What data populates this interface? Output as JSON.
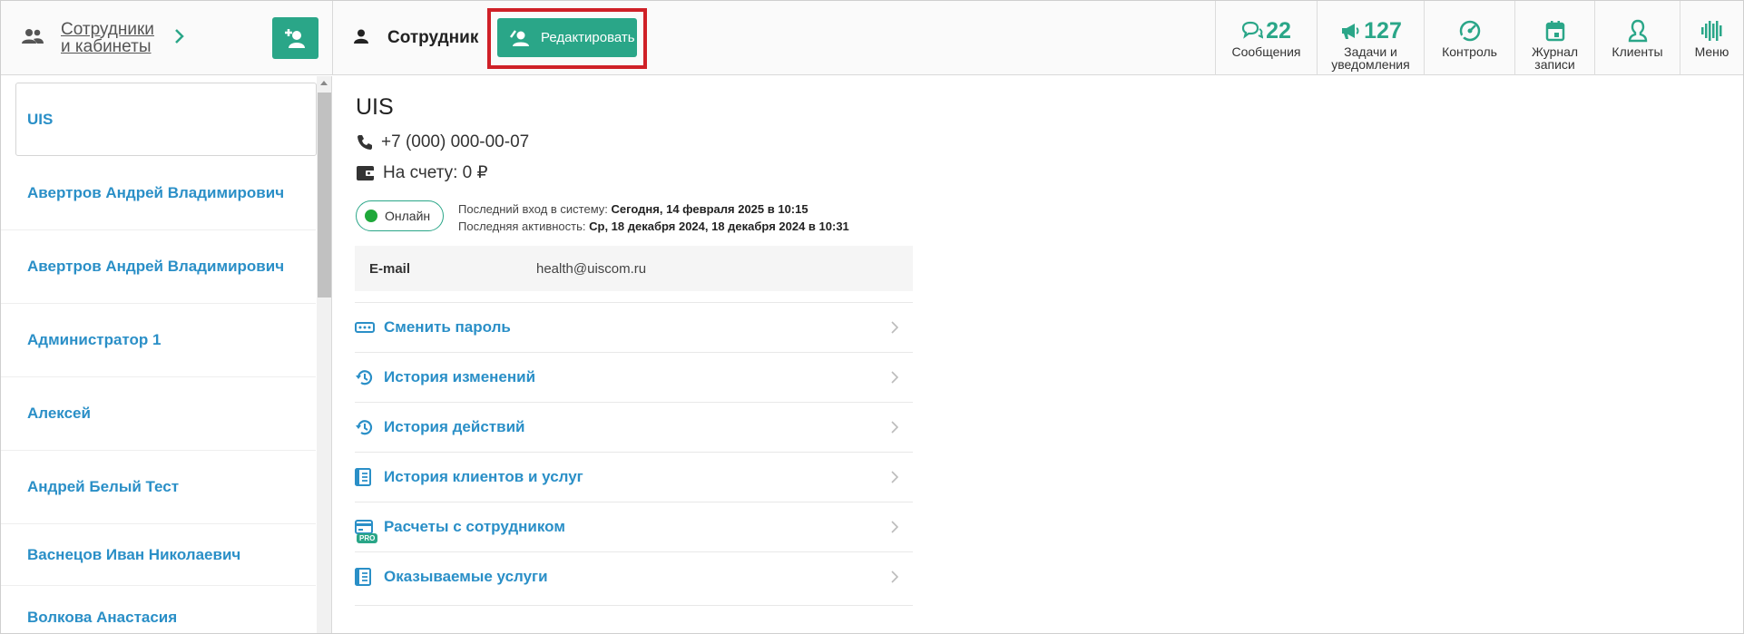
{
  "header": {
    "staff_title_line1": "Сотрудники",
    "staff_title_line2": "и кабинеты",
    "employee_label": "Сотрудник",
    "edit_label": "Редактировать",
    "nav": [
      {
        "icon": "chat-bubbles-icon",
        "count": "22",
        "label": "Сообщения"
      },
      {
        "icon": "megaphone-icon",
        "count": "127",
        "label_line1": "Задачи и",
        "label_line2": "уведомления"
      },
      {
        "icon": "speedometer-icon",
        "label": "Контроль"
      },
      {
        "icon": "calendar-icon",
        "label_line1": "Журнал",
        "label_line2": "записи"
      },
      {
        "icon": "client-person-icon",
        "label": "Клиенты"
      },
      {
        "icon": "menu-logo-icon",
        "label": "Меню"
      }
    ]
  },
  "list": {
    "items": [
      "UIS",
      "Авертров Андрей Владимирович",
      "Авертров Андрей Владимирович",
      "Администратор 1",
      "Алексей",
      "Андрей Белый Тест",
      "Васнецов Иван Николаевич",
      "Волкова Анастасия"
    ]
  },
  "employee": {
    "name": "UIS",
    "phone": "+7 (000) 000-00-07",
    "balance": "На счету: 0 ₽",
    "status": "Онлайн",
    "last_login_label": "Последний вход в систему:",
    "last_login_value": "Сегодня, 14 февраля 2025 в 10:15",
    "last_activity_label": "Последняя активность:",
    "last_activity_value": "Ср, 18 декабря 2024, 18 декабря 2024 в 10:31",
    "email_key": "E-mail",
    "email_value": "health@uiscom.ru"
  },
  "menu": [
    {
      "icon": "password-icon",
      "label": "Сменить пароль"
    },
    {
      "icon": "history-icon",
      "label": "История изменений"
    },
    {
      "icon": "history-icon",
      "label": "История действий"
    },
    {
      "icon": "list-book-icon",
      "label": "История клиентов и услуг"
    },
    {
      "icon": "card-icon",
      "label": "Расчеты с сотрудником",
      "badge": "PRO"
    },
    {
      "icon": "list-book-icon",
      "label": "Оказываемые услуги"
    }
  ],
  "colors": {
    "accent": "#2aa688",
    "link": "#2a8fc7",
    "highlight": "#cf2027",
    "online": "#1fa83a"
  }
}
